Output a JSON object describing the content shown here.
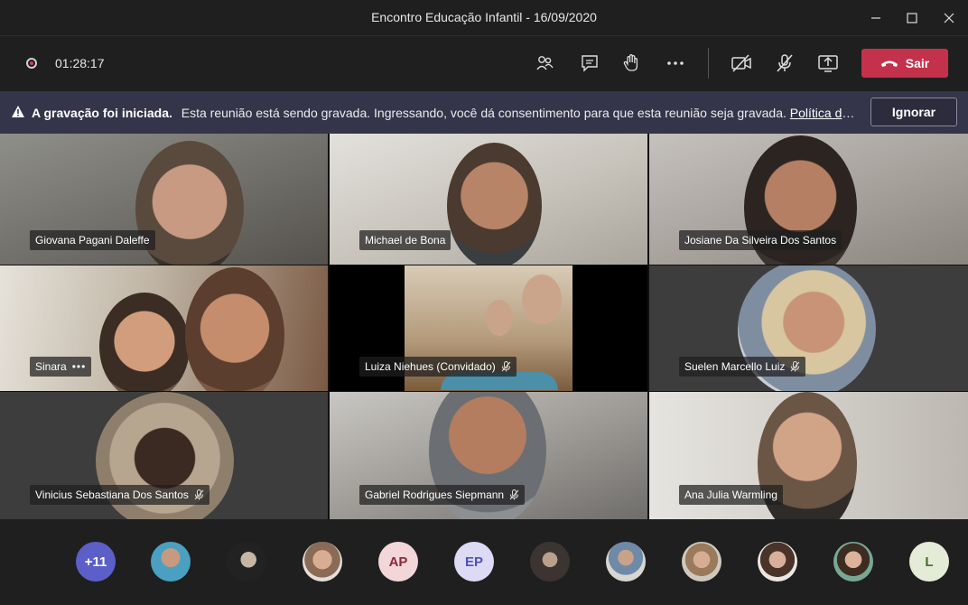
{
  "window": {
    "title": "Encontro Educação Infantil - 16/09/2020"
  },
  "toolbar": {
    "recording_time": "01:28:17",
    "leave_label": "Sair",
    "colors": {
      "leave": "#c4314b",
      "recording": "#e3374b"
    },
    "icons": [
      "participants-icon",
      "chat-icon",
      "raise-hand-icon",
      "more-icon",
      "camera-off-icon",
      "mic-off-icon",
      "share-screen-icon",
      "phone-hangup-icon"
    ]
  },
  "banner": {
    "title": "A gravação foi iniciada.",
    "message": "Esta reunião está sendo gravada. Ingressando, você dá consentimento para que esta reunião seja gravada.",
    "link": "Política de privacidade",
    "ignore_label": "Ignorar"
  },
  "participants": [
    {
      "name": "Giovana Pagani Daleffe",
      "muted": false
    },
    {
      "name": "Michael de Bona",
      "muted": false
    },
    {
      "name": "Josiane Da Silveira Dos Santos",
      "muted": false
    },
    {
      "name": "Sinara",
      "muted": false,
      "more": "•••"
    },
    {
      "name": "Luiza Niehues (Convidado)",
      "muted": true
    },
    {
      "name": "Suelen Marcello Luiz",
      "muted": true
    },
    {
      "name": "Vinicius Sebastiana Dos Santos",
      "muted": true
    },
    {
      "name": "Gabriel Rodrigues Siepmann",
      "muted": true
    },
    {
      "name": "Ana Julia Warmling",
      "muted": false
    }
  ],
  "roster": {
    "overflow": "+11",
    "initials": [
      "AP",
      "EP",
      "L"
    ]
  }
}
